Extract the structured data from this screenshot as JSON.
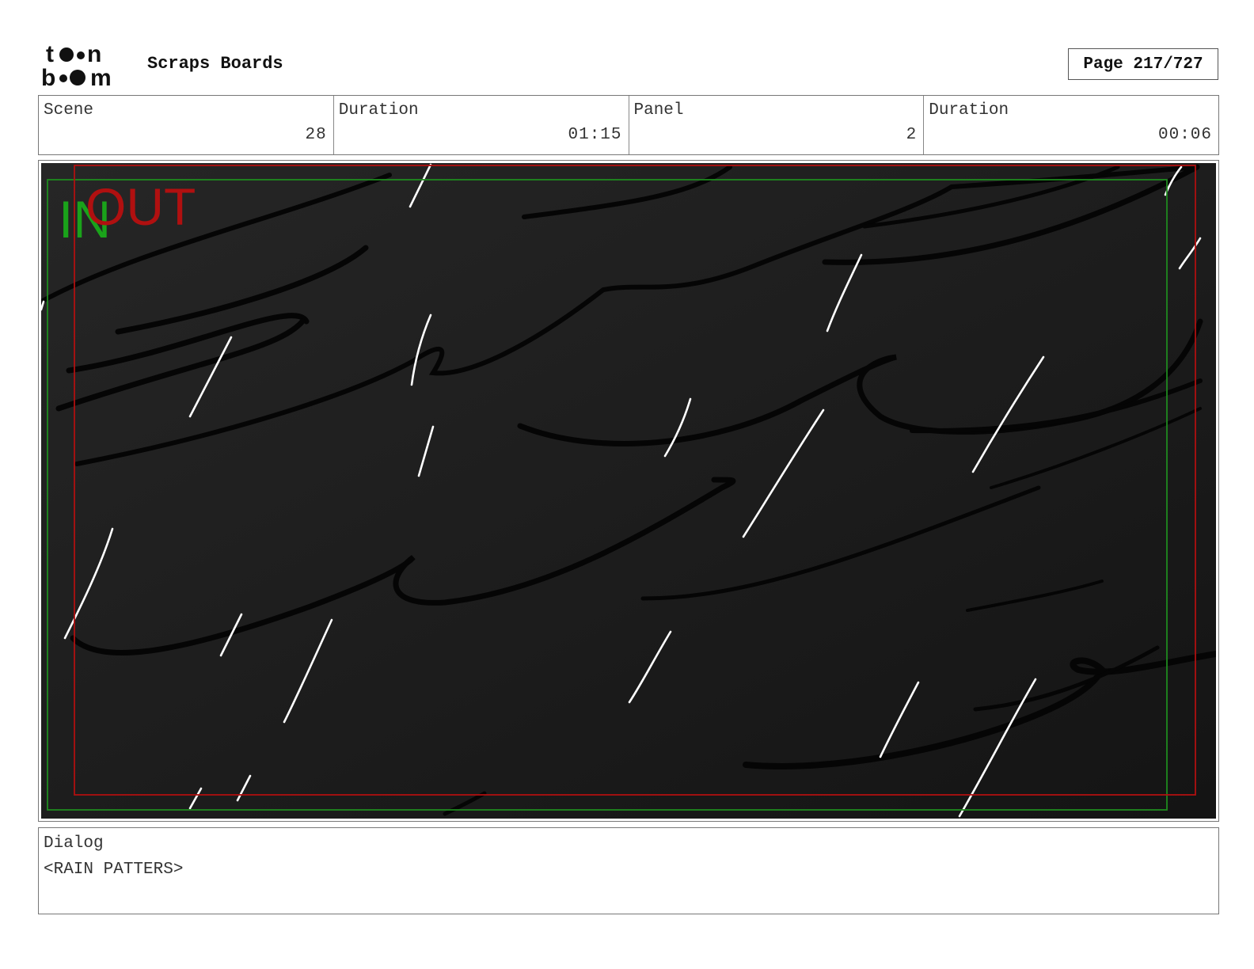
{
  "header": {
    "logo_text": "toon boom",
    "project_title": "Scraps Boards",
    "page_label": "Page 217/727"
  },
  "info": {
    "scene_label": "Scene",
    "scene_value": "28",
    "scene_duration_label": "Duration",
    "scene_duration_value": "01:15",
    "panel_label": "Panel",
    "panel_value": "2",
    "panel_duration_label": "Duration",
    "panel_duration_value": "00:06"
  },
  "panel": {
    "in_label": "IN",
    "out_label": "OUT",
    "in_color": "#1aa31a",
    "out_color": "#b01010",
    "background_color": "#1e1e1e"
  },
  "dialog": {
    "label": "Dialog",
    "text": "<RAIN PATTERS>"
  }
}
